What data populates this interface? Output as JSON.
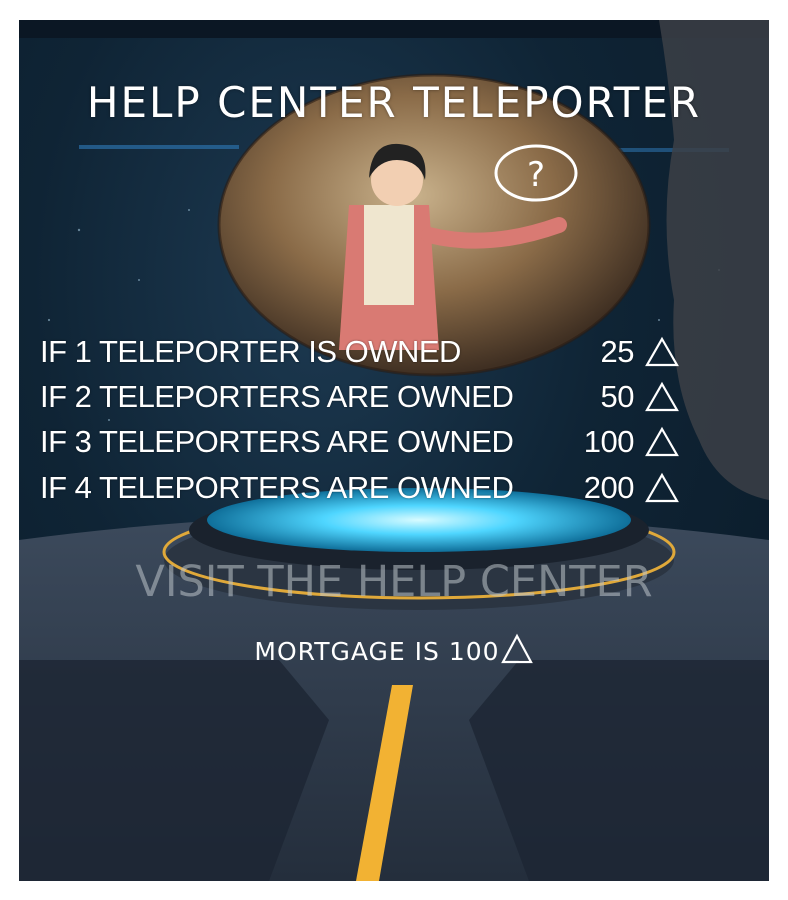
{
  "title": "HELP CENTER TELEPORTER",
  "floor_label": "VISIT THE HELP CENTER",
  "rent_rows": [
    {
      "label": "IF 1 TELEPORTER IS OWNED",
      "value": "25"
    },
    {
      "label": "IF 2 TELEPORTERS ARE OWNED",
      "value": "50"
    },
    {
      "label": "IF 3 TELEPORTERS ARE OWNED",
      "value": "100"
    },
    {
      "label": "IF 4 TELEPORTERS ARE OWNED",
      "value": "200"
    }
  ],
  "mortgage": "MORTGAGE IS 100",
  "currency_icon": "triangle-currency-icon",
  "help_badge_icon": "question-mark-icon",
  "colors": {
    "background": "#0f2435",
    "portal_glow": "#4fd6ff",
    "ring_accent": "#e0a93a",
    "path_stripe": "#f2b233"
  }
}
